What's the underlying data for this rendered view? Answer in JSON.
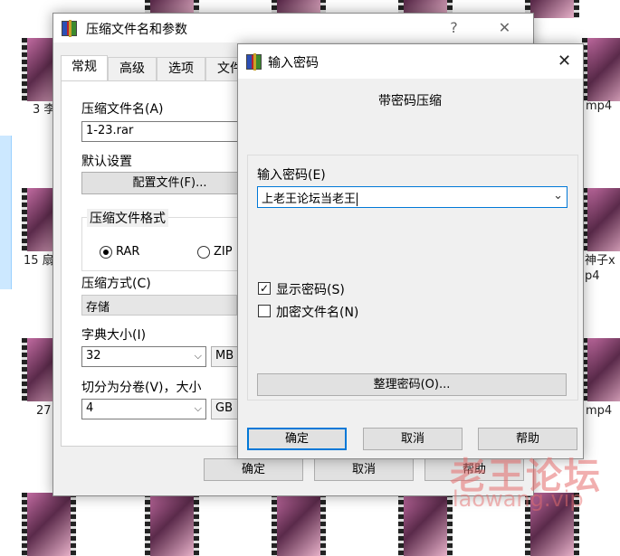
{
  "explorer": {
    "tile_labels": [
      "3 李",
      "15 扇",
      "27",
      "mp4",
      "神子x",
      "p4",
      "mp4"
    ]
  },
  "archive_dialog": {
    "title": "压缩文件名和参数",
    "help": "?",
    "close": "✕",
    "tabs": [
      "常规",
      "高级",
      "选项",
      "文件"
    ],
    "archive_name_label": "压缩文件名(A)",
    "archive_name_value": "1-23.rar",
    "default_settings_label": "默认设置",
    "profiles_button": "配置文件(F)...",
    "format_group_label": "压缩文件格式",
    "format_options": [
      {
        "label": "RAR",
        "checked": true
      },
      {
        "label": "ZIP",
        "checked": false
      }
    ],
    "method_label": "压缩方式(C)",
    "method_value": "存储",
    "dict_label": "字典大小(I)",
    "dict_value": "32",
    "dict_unit": "MB",
    "split_label": "切分为分卷(V)，大小",
    "split_value": "4",
    "split_unit": "GB",
    "ok_button": "确定",
    "cancel_button": "取消",
    "help_button": "帮助"
  },
  "password_dialog": {
    "title": "输入密码",
    "close": "✕",
    "heading": "带密码压缩",
    "password_label": "输入密码(E)",
    "password_value": "上老王论坛当老王",
    "show_password": {
      "label": "显示密码(S)",
      "checked": true
    },
    "encrypt_names": {
      "label": "加密文件名(N)",
      "checked": false
    },
    "organize_button": "整理密码(O)...",
    "ok_button": "确定",
    "cancel_button": "取消",
    "help_button": "帮助"
  },
  "watermark": {
    "text": "老王论坛",
    "url": "laowang.vip"
  },
  "colors": {
    "accent": "#0078d7",
    "dialog_bg": "#f0f0f0",
    "selection": "#cce8ff"
  }
}
